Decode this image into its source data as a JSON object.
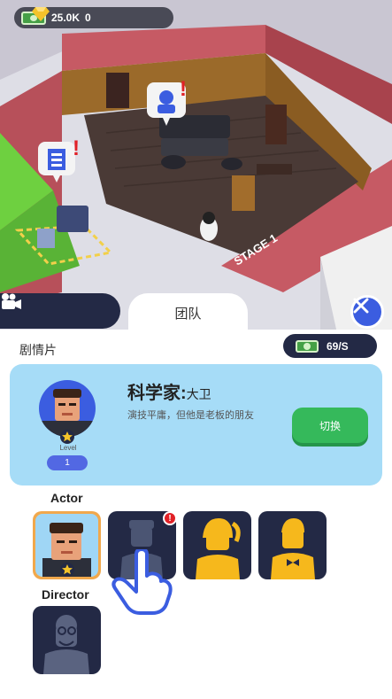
{
  "hud": {
    "cash": "25.0K",
    "gems": "0"
  },
  "scene": {
    "stage_sign": "STAGE 1"
  },
  "tabs": {
    "team_label": "团队"
  },
  "panel": {
    "section_title": "剧情片",
    "income_rate": "69/S",
    "role": {
      "name": "科学家:",
      "actor_name": "大卫",
      "description": "演技平庸，但他是老板的朋友",
      "level_label": "Level",
      "level": "1",
      "switch_label": "切换"
    },
    "groups": [
      {
        "label": "Actor"
      },
      {
        "label": "Director"
      }
    ],
    "alert_badge": "!"
  },
  "colors": {
    "accent": "#3b5de0",
    "dark": "#232945",
    "switch": "#35b95b",
    "card": "#a6dcf7",
    "alert": "#e12127"
  }
}
